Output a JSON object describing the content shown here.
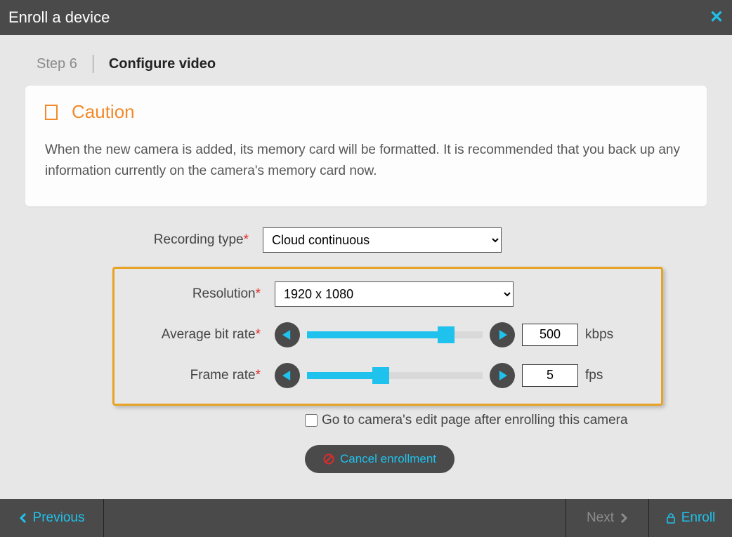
{
  "header": {
    "title": "Enroll a device"
  },
  "step": {
    "label": "Step 6",
    "title": "Configure video"
  },
  "caution": {
    "title": "Caution",
    "text": "When the new camera is added, its memory card will be formatted. It is recommended that you back up any information currently on the camera's memory card now."
  },
  "form": {
    "recording_type": {
      "label": "Recording type",
      "value": "Cloud continuous"
    },
    "resolution": {
      "label": "Resolution",
      "value": "1920 x 1080"
    },
    "bitrate": {
      "label": "Average bit rate",
      "value": "500",
      "unit": "kbps",
      "slider_pct": 79
    },
    "framerate": {
      "label": "Frame rate",
      "value": "5",
      "unit": "fps",
      "slider_pct": 42
    },
    "goto_edit": {
      "label": "Go to camera's edit page after enrolling this camera",
      "checked": false
    },
    "cancel": {
      "label": "Cancel enrollment"
    }
  },
  "footer": {
    "previous": "Previous",
    "next": "Next",
    "enroll": "Enroll"
  }
}
